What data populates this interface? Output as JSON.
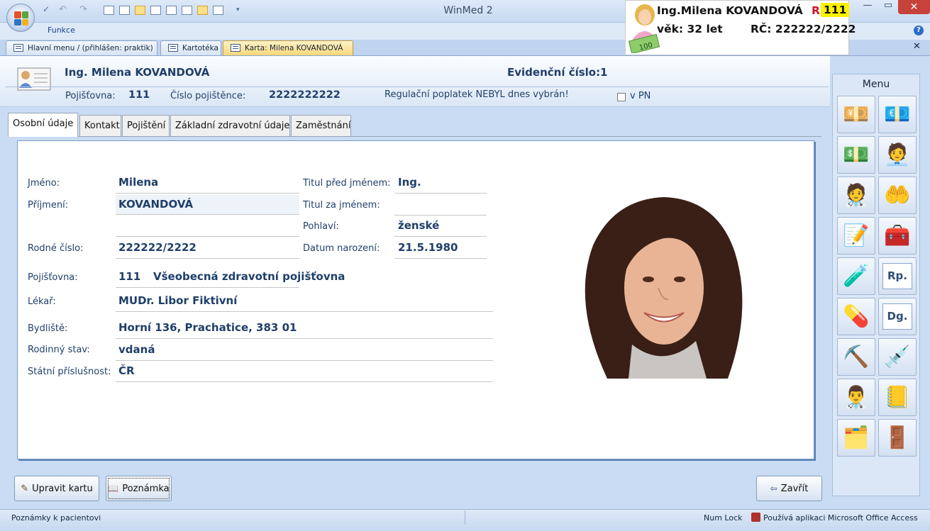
{
  "window": {
    "title": "WinMed 2",
    "ribbon_tab": "Funkce"
  },
  "doc_tabs": [
    {
      "label": "Hlavní menu / (přihlášen: praktik)"
    },
    {
      "label": "Kartotéka"
    },
    {
      "label": "Karta: Milena KOVANDOVÁ"
    }
  ],
  "banner": {
    "name": "Ing.Milena KOVANDOVÁ",
    "r_label": "R",
    "r_value": "111",
    "age": "věk: 32  let",
    "rc": "RČ: 222222/2222",
    "money_text": "100"
  },
  "header": {
    "patient_name": "Ing. Milena KOVANDOVÁ",
    "evid_label": "Evidenční číslo:",
    "evid_value": "1",
    "pojistovna_label": "Pojišťovna:",
    "pojistovna_value": "111",
    "cislo_label": "Číslo pojištěnce:",
    "cislo_value": "2222222222",
    "reg_note": "Regulační poplatek NEBYL dnes vybrán!",
    "pn_label": "v PN"
  },
  "tabs": [
    {
      "label": "Osobní údaje"
    },
    {
      "label": "Kontakt"
    },
    {
      "label": "Pojištění"
    },
    {
      "label": "Základní zdravotní údaje"
    },
    {
      "label": "Zaměstnání"
    }
  ],
  "form": {
    "jmeno_label": "Jméno:",
    "jmeno": "Milena",
    "prijmeni_label": "Příjmení:",
    "prijmeni": "KOVANDOVÁ",
    "rc_label": "Rodné číslo:",
    "rc": "222222/2222",
    "titul_pred_label": "Titul před jménem:",
    "titul_pred": "Ing.",
    "titul_za_label": "Titul za jménem:",
    "titul_za": "",
    "pohlavi_label": "Pohlaví:",
    "pohlavi": "ženské",
    "datum_label": "Datum narození:",
    "datum": "21.5.1980",
    "pojistovna_label": "Pojišťovna:",
    "pojistovna_code": "111",
    "pojistovna_name": "Všeobecná zdravotní pojišťovna",
    "lekar_label": "Lékař:",
    "lekar": "MUDr. Libor Fiktivní",
    "bydliste_label": "Bydliště:",
    "bydliste": "Horní 136, Prachatice, 383 01",
    "rodinny_label": "Rodinný stav:",
    "rodinny": "vdaná",
    "statni_label": "Státní příslušnost:",
    "statni": "ČR"
  },
  "menu": {
    "title": "Menu",
    "icons": [
      "coins-money-icon",
      "coins-cash-icon",
      "hand-money-icon",
      "coins-person-icon",
      "nurse-coins-icon",
      "hand-card-icon",
      "edit-form-icon",
      "medical-bag-icon",
      "test-tube-icon",
      "rp-document-icon",
      "medicine-bottles-icon",
      "dg-document-icon",
      "shovel-cross-icon",
      "syringe-icon",
      "doctor-warning-icon",
      "notes-document-icon",
      "card-file-icon",
      "exit-door-icon"
    ],
    "glyphs": [
      "💴",
      "💶",
      "💵",
      "🧑‍💼",
      "🧑‍⚕️",
      "🤲",
      "📝",
      "🧰",
      "🧪",
      "Rp.",
      "💊",
      "Dg.",
      "⛏️",
      "💉",
      "👨‍⚕️",
      "📒",
      "🗂️",
      "🚪"
    ]
  },
  "buttons": {
    "edit": "Upravit kartu",
    "note": "Poznámka",
    "close": "Zavřít"
  },
  "status": {
    "left": "Poznámky k pacientovi",
    "numlock": "Num Lock",
    "access": "Používá aplikaci Microsoft Office Access"
  }
}
